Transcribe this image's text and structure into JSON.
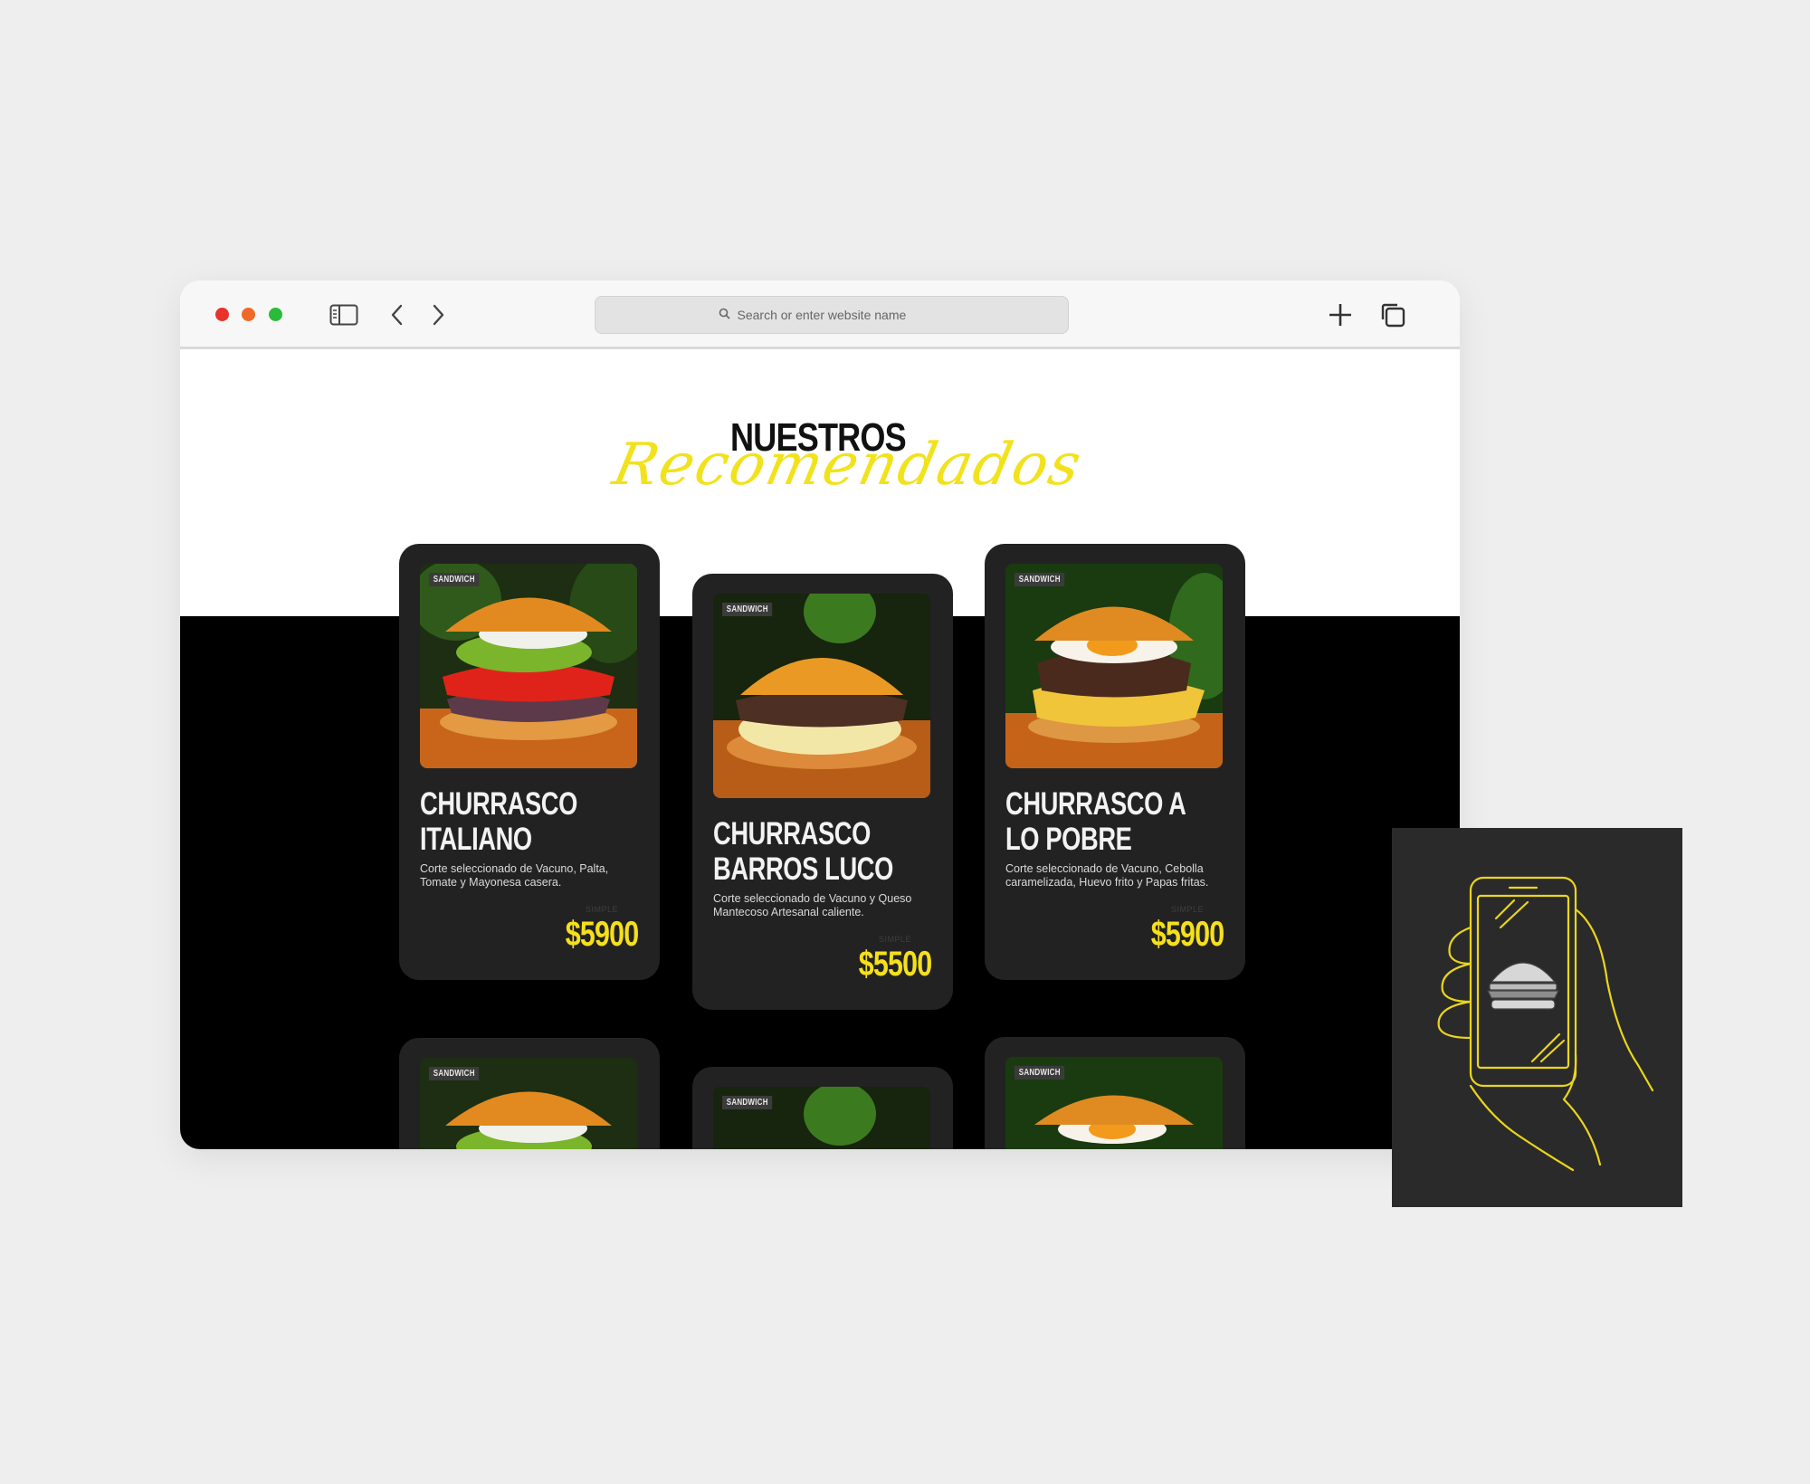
{
  "browser": {
    "address_placeholder": "Search or enter website name"
  },
  "section": {
    "title_main": "NUESTROS",
    "title_script": "Recomendados"
  },
  "cards": [
    {
      "badge": "SANDWICH",
      "title": "CHURRASCO ITALIANO",
      "description": "Corte seleccionado de Vacuno, Palta, Tomate y Mayonesa casera.",
      "size": "SIMPLE",
      "price": "$5900"
    },
    {
      "badge": "SANDWICH",
      "title": "CHURRASCO BARROS LUCO",
      "description": "Corte seleccionado de Vacuno y Queso Mantecoso Artesanal caliente.",
      "size": "SIMPLE",
      "price": "$5500"
    },
    {
      "badge": "SANDWICH",
      "title": "CHURRASCO A LO POBRE",
      "description": "Corte seleccionado de Vacuno, Cebolla caramelizada, Huevo frito y Papas fritas.",
      "size": "SIMPLE",
      "price": "$5900"
    },
    {
      "badge": "SANDWICH"
    },
    {
      "badge": "SANDWICH"
    },
    {
      "badge": "SANDWICH"
    }
  ],
  "colors": {
    "accent_yellow": "#f5e01b",
    "card_bg": "#232223",
    "band_bg": "#000000",
    "page_bg": "#efeeef"
  }
}
